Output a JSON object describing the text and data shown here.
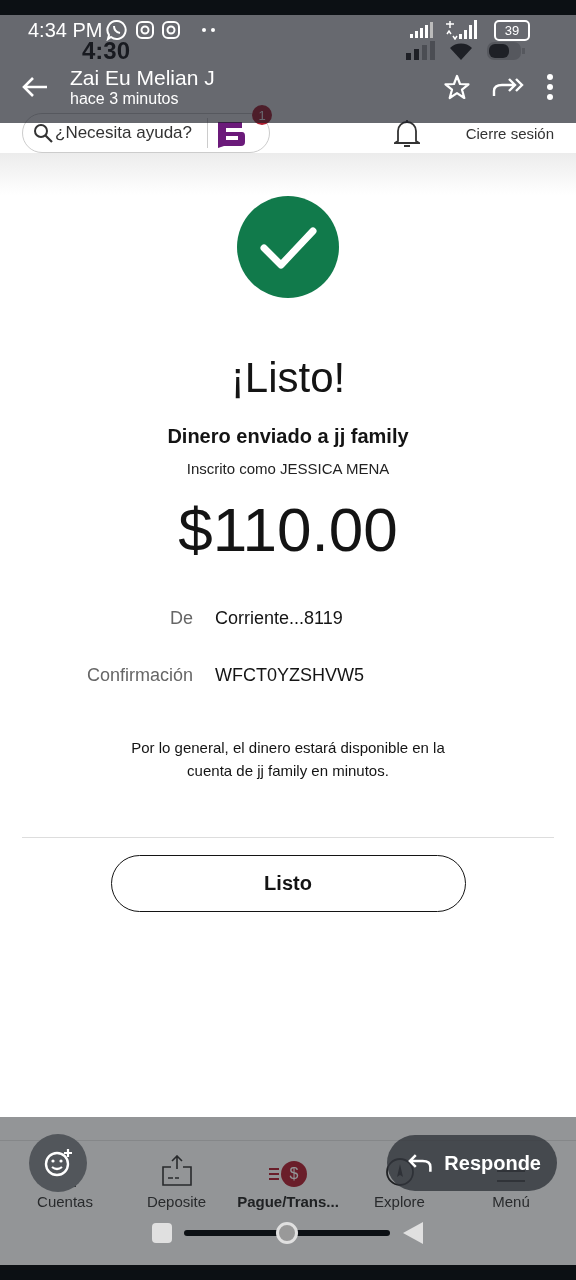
{
  "viewer": {
    "status_bar": {
      "time": "4:34 PM",
      "battery": "39"
    },
    "sender": "Zai Eu Melian J",
    "timestamp": "hace 3 minutos",
    "reply_button": "Responde"
  },
  "screenshot": {
    "status_bar": {
      "time": "4:30"
    },
    "search": {
      "placeholder": "¿Necesita ayuda?"
    },
    "chat_badge": "1",
    "logout": "Cierre sesión",
    "title": "¡Listo!",
    "heading": "Dinero enviado a jj family",
    "subheading": "Inscrito como JESSICA MENA",
    "amount": "$110.00",
    "details": [
      {
        "label": "De",
        "value": "Corriente...8119"
      },
      {
        "label": "Confirmación",
        "value": "WFCT0YZSHVW5"
      }
    ],
    "note": "Por lo general, el dinero estará disponible en la cuenta de jj family en minutos.",
    "button": "Listo",
    "nav": [
      {
        "kind": "accounts",
        "label": "Cuentas",
        "selected": false
      },
      {
        "kind": "deposit",
        "label": "Deposite",
        "selected": false
      },
      {
        "kind": "pay",
        "label": "Pague/Trans...",
        "selected": true,
        "glyph": "$"
      },
      {
        "kind": "explore",
        "label": "Explore",
        "selected": false
      },
      {
        "kind": "menu",
        "label": "Menú",
        "selected": false
      }
    ]
  }
}
